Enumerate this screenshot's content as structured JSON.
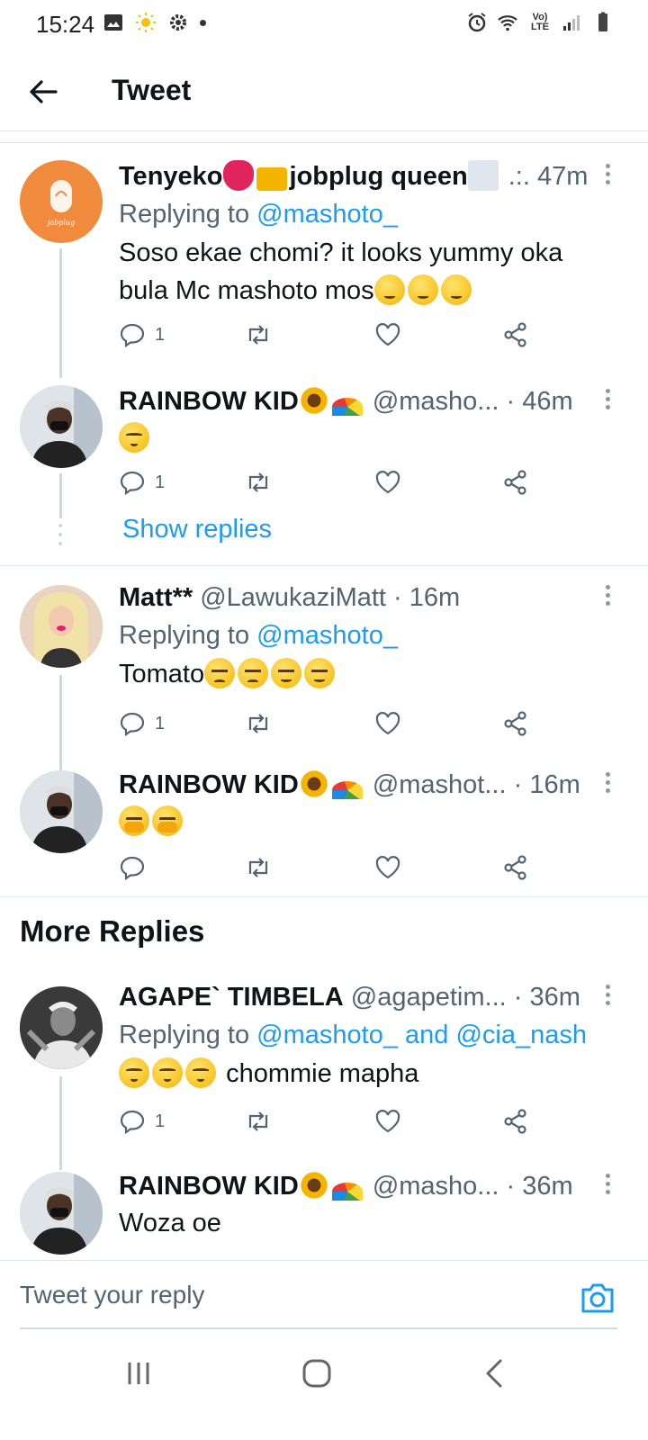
{
  "status_bar": {
    "time": "15:24",
    "network_label": "Vo) LTE"
  },
  "header": {
    "title": "Tweet"
  },
  "tweets": [
    {
      "name": "Tenyeko",
      "name_suffix": "jobplug queen",
      "separator": ".:.",
      "time": "47m",
      "replying_prefix": "Replying to ",
      "replying_to": "@mashoto_",
      "text": "Soso ekae chomi? it looks yummy oka bula Mc mashoto mos",
      "reply_count": "1"
    },
    {
      "name": "RAINBOW KID",
      "handle": "@masho...",
      "separator": "·",
      "time": "46m",
      "reply_count": "1"
    },
    {
      "name": "Matt**",
      "handle": "@LawukaziMatt",
      "separator": "·",
      "time": "16m",
      "replying_prefix": "Replying to ",
      "replying_to": "@mashoto_",
      "text": "Tomato",
      "reply_count": "1"
    },
    {
      "name": "RAINBOW KID",
      "handle": "@mashot...",
      "separator": "·",
      "time": "16m"
    },
    {
      "name": "AGAPE` TIMBELA",
      "handle": "@agapetim...",
      "separator": "·",
      "time": "36m",
      "replying_prefix": "Replying to ",
      "replying_to": "@mashoto_ and @cia_nash",
      "text": "chommie mapha",
      "reply_count": "1"
    },
    {
      "name": "RAINBOW KID",
      "handle": "@masho...",
      "separator": "·",
      "time": "36m",
      "text": "Woza oe"
    }
  ],
  "show_replies_label": "Show replies",
  "more_replies_title": "More Replies",
  "compose": {
    "placeholder": "Tweet your reply"
  },
  "colors": {
    "accent": "#1d9bf0",
    "secondary_text": "#536471",
    "divider": "#e1e8ed"
  }
}
